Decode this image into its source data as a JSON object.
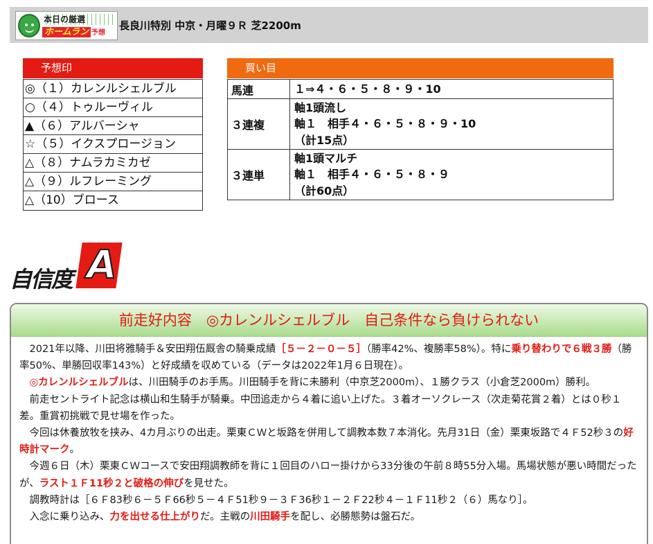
{
  "header": {
    "logo_top": "本日の厳選",
    "logo_brand": "ホームラン",
    "logo_suffix": "予想",
    "race_title": "長良川特別 中京・月曜９Ｒ 芝2200m"
  },
  "yoso": {
    "heading": "予想印",
    "marks": [
      "◎（１）カレンルシェルブル",
      "○（４）トゥルーヴィル",
      "▲（６）アルバーシャ",
      "☆（５）イクスプロージョン",
      "△（８）ナムラカミカゼ",
      "△（９）ルフレーミング",
      "△（10）ブロース"
    ]
  },
  "kaime": {
    "heading": "買い目",
    "rows": [
      {
        "type": "馬連",
        "lines": [
          "１⇒４・６・５・８・９・10"
        ]
      },
      {
        "type": "３連複",
        "lines": [
          "軸1頭流し",
          "軸１　相手４・６・５・８・９・10",
          "（計15点）"
        ]
      },
      {
        "type": "３連単",
        "lines": [
          "軸1頭マルチ",
          "軸１　相手４・６・５・８・９",
          "（計60点）"
        ]
      }
    ]
  },
  "confidence": {
    "label": "自信度",
    "rank": "A"
  },
  "comment": {
    "headline": "前走好内容　◎カレンルシェルブル　自己条件なら負けられない",
    "paragraphs": [
      [
        {
          "t": "2021年以降、川田将雅騎手＆安田翔伍厩舎の騎乗成績"
        },
        {
          "t": "［５－２－０－５］",
          "h": true
        },
        {
          "t": "（勝率42%、複勝率58%）。特に"
        },
        {
          "t": "乗り替わりで６戦３勝",
          "h": true
        },
        {
          "t": "（勝率50%、単勝回収率143%）と好成績を収めている（データは2022年1月６日現在）。"
        }
      ],
      [
        {
          "t": "◎カレンルシェルブル",
          "h": true
        },
        {
          "t": "は、川田騎手のお手馬。川田騎手を背に未勝利（中京芝2000m）、１勝クラス（小倉芝2000m）勝利。"
        }
      ],
      [
        {
          "t": "前走セントライト記念は横山和生騎手が騎乗。中団追走から４着に追い上げた。３着オーソクレース（次走菊花賞２着）とは０秒１差。重賞初挑戦で見せ場を作った。"
        }
      ],
      [
        {
          "t": "今回は休養放牧を挟み、4カ月ぶりの出走。栗東ＣＷと坂路を併用して調教本数７本消化。先月31日（金）栗東坂路で４Ｆ52秒３の"
        },
        {
          "t": "好時計マーク",
          "h": true
        },
        {
          "t": "。"
        }
      ],
      [
        {
          "t": "今週６日（木）栗東ＣＷコースで安田翔調教師を背に１回目のハロー掛けから33分後の午前８時55分入場。馬場状態が悪い時間だったが、"
        },
        {
          "t": "ラスト１Ｆ11秒２と破格の伸び",
          "h": true
        },
        {
          "t": "を見せた。"
        }
      ],
      [
        {
          "t": "調教時計は［６Ｆ83秒６－５Ｆ66秒５－４Ｆ51秒９－３Ｆ36秒１－２Ｆ22秒４－１Ｆ11秒２（６）馬なり］。"
        }
      ],
      [
        {
          "t": "入念に乗り込み、"
        },
        {
          "t": "力を出せる仕上がり",
          "h": true
        },
        {
          "t": "だ。主戦の"
        },
        {
          "t": "川田騎手",
          "h": true
        },
        {
          "t": "を配し、必勝態勢は盤石だ。"
        }
      ]
    ]
  }
}
